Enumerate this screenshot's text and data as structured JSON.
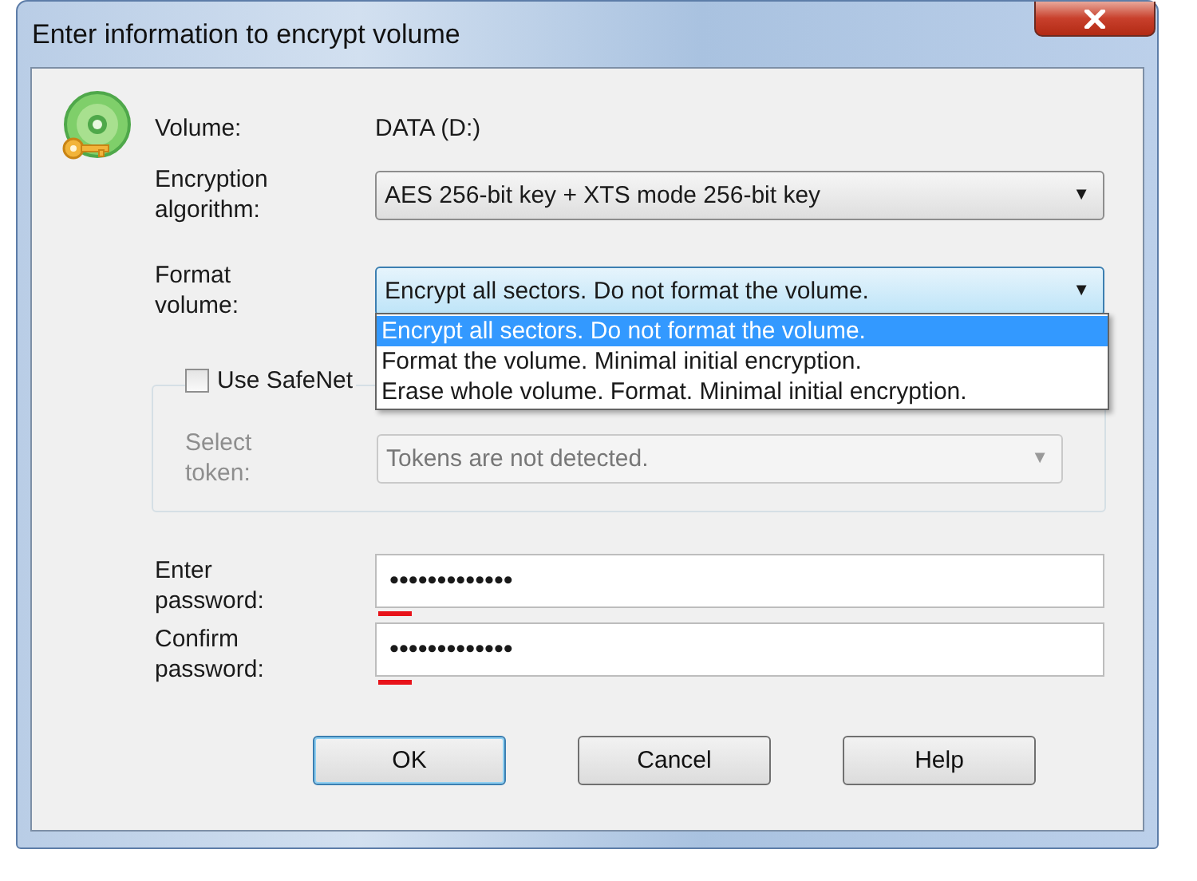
{
  "window": {
    "title": "Enter information to encrypt volume"
  },
  "volume": {
    "label": "Volume:",
    "value": "DATA (D:)"
  },
  "encryption_algorithm": {
    "label": "Encryption\nalgorithm:",
    "value": "AES 256-bit key + XTS mode 256-bit key",
    "arrow": "▼"
  },
  "format_volume": {
    "label": "Format\nvolume:",
    "value": "Encrypt all sectors. Do not format the volume.",
    "arrow": "▼",
    "open": true,
    "options": [
      {
        "label": "Encrypt all sectors. Do not format the volume.",
        "selected": true
      },
      {
        "label": "Format the volume. Minimal initial encryption.",
        "selected": false
      },
      {
        "label": "Erase whole volume. Format. Minimal initial encryption.",
        "selected": false
      }
    ]
  },
  "safenet": {
    "checkbox": {
      "label": "Use SafeNet",
      "checked": false
    },
    "token_label": "Select\ntoken:",
    "token_value": "Tokens are not detected.",
    "arrow": "▼",
    "disabled": true
  },
  "passwords": [
    {
      "label": "Enter\npassword:",
      "value": "•••••••••••••"
    },
    {
      "label": "Confirm\npassword:",
      "value": "•••••••••••••"
    }
  ],
  "buttons": [
    {
      "label": "OK",
      "default": true
    },
    {
      "label": "Cancel",
      "default": false
    },
    {
      "label": "Help",
      "default": false
    }
  ]
}
